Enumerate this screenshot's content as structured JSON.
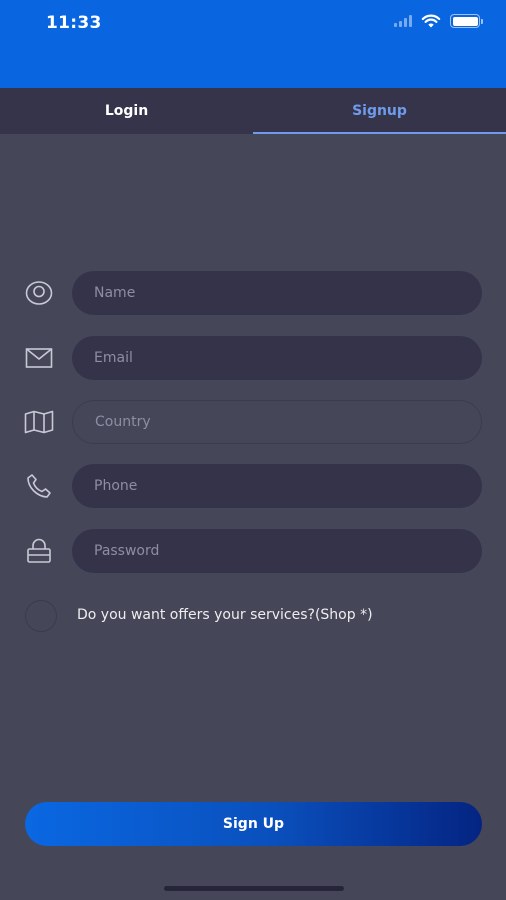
{
  "status_bar": {
    "time": "11:33",
    "icons": [
      "signal-icon",
      "wifi-icon",
      "battery-icon"
    ]
  },
  "tabs": [
    {
      "label": "Login",
      "active": false
    },
    {
      "label": "Signup",
      "active": true
    }
  ],
  "form": {
    "name": {
      "placeholder": "Name",
      "value": "",
      "icon": "user-circle-icon"
    },
    "email": {
      "placeholder": "Email",
      "value": "",
      "icon": "mail-icon"
    },
    "country": {
      "placeholder": "Country",
      "value": "",
      "icon": "map-icon"
    },
    "phone": {
      "placeholder": "Phone",
      "value": "",
      "icon": "phone-icon"
    },
    "password": {
      "placeholder": "Password",
      "value": "",
      "icon": "lock-icon"
    }
  },
  "shop_option": {
    "label": "Do you want offers your services?(Shop *)",
    "checked": false
  },
  "submit_label": "Sign Up",
  "colors": {
    "header": "#0a66e0",
    "background": "#464659",
    "tabbar": "#35344a",
    "field": "#34334a",
    "active_tab": "#6f9bea",
    "button_start": "#0a68e2",
    "button_end": "#042482"
  }
}
